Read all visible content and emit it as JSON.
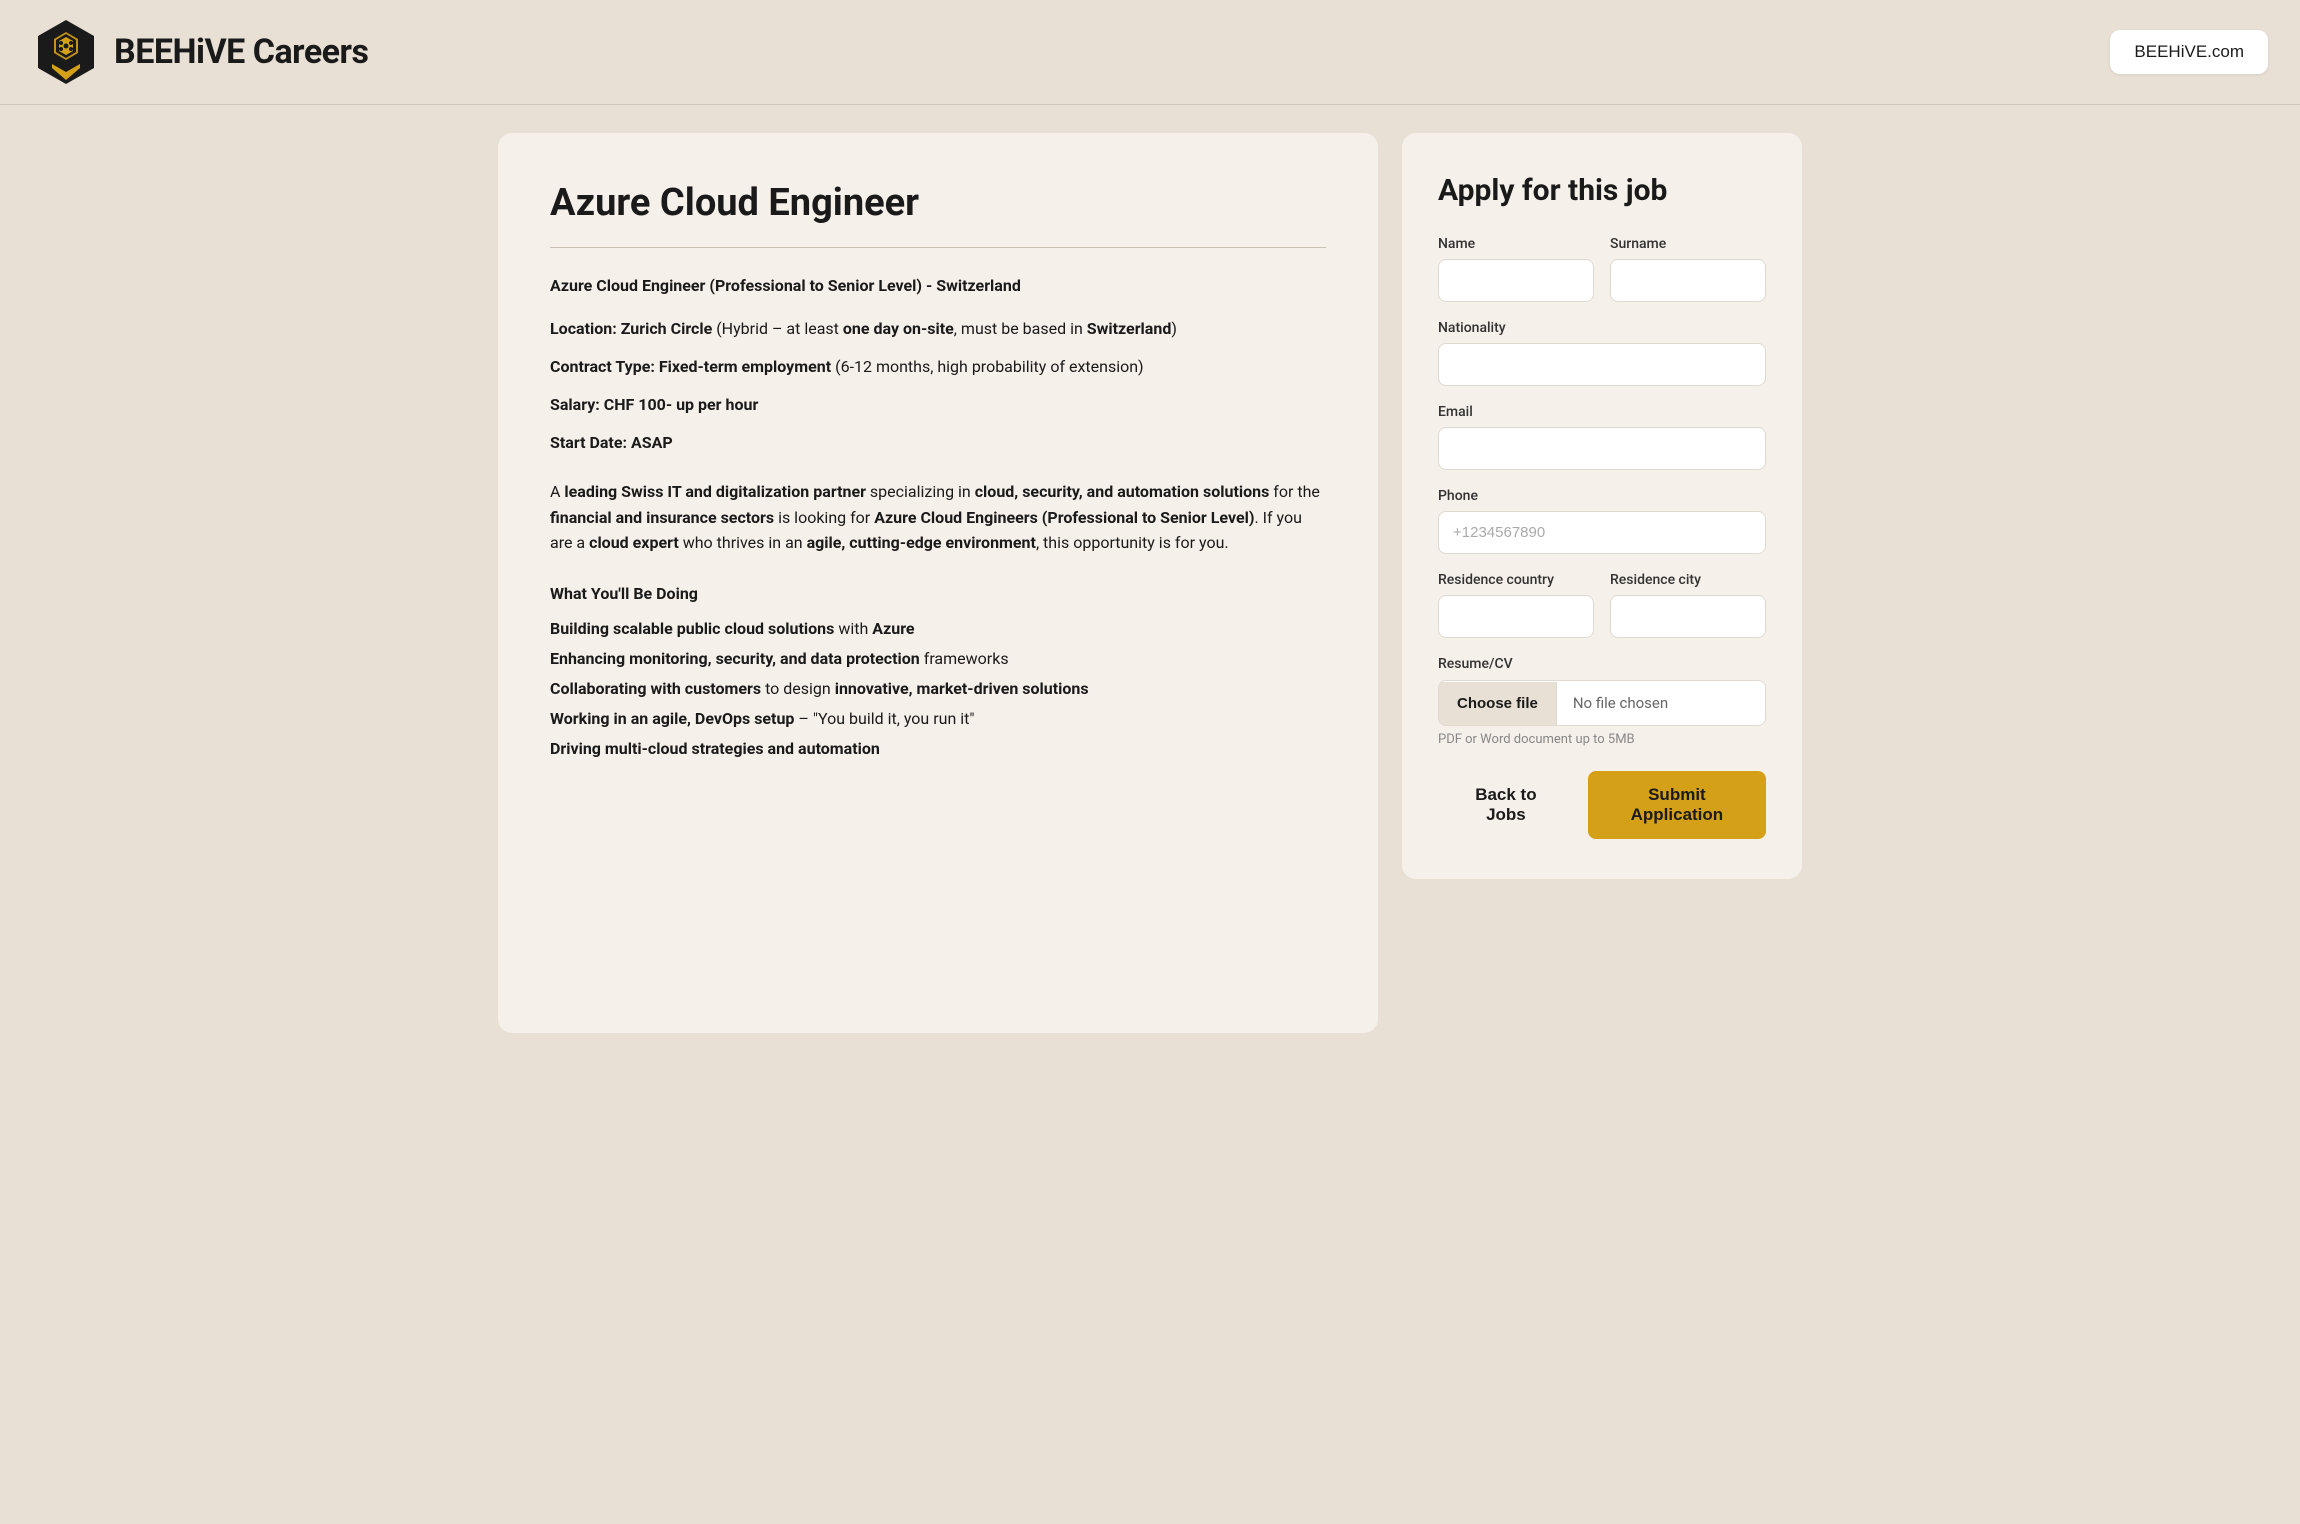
{
  "header": {
    "logo_text": "BEEHiVE Careers",
    "site_link": "BEEHiVE.com"
  },
  "job": {
    "title": "Azure Cloud Engineer",
    "subtitle": "Azure Cloud Engineer (Professional to Senior Level) - Switzerland",
    "details": [
      {
        "label": "Location: Zurich Circle",
        "rest": "(Hybrid – at least ",
        "bold_mid": "one day on-site",
        "rest2": ", must be based in ",
        "bold_end": "Switzerland",
        "suffix": ")"
      }
    ],
    "contract": "Contract Type: Fixed-term employment",
    "contract_rest": "(6-12 months, high probability of extension)",
    "salary": "Salary: CHF 100- up per hour",
    "start_date": "Start Date: ASAP",
    "intro": "A leading Swiss IT and digitalization partner specializing in cloud, security, and automation solutions for the financial and insurance sectors is looking for Azure Cloud Engineers (Professional to Senior Level). If you are a cloud expert who thrives in an agile, cutting-edge environment, this opportunity is for you.",
    "what_heading": "What You'll Be Doing",
    "doing_items": [
      "Building scalable public cloud solutions with Azure",
      "Enhancing monitoring, security, and data protection frameworks",
      "Collaborating with customers to design innovative, market-driven solutions",
      "Working in an agile, DevOps setup – \"You build it, you run it\"",
      "Driving multi-cloud strategies and automation"
    ]
  },
  "form": {
    "title": "Apply for this job",
    "name_label": "Name",
    "surname_label": "Surname",
    "nationality_label": "Nationality",
    "email_label": "Email",
    "phone_label": "Phone",
    "phone_placeholder": "+1234567890",
    "residence_country_label": "Residence country",
    "residence_city_label": "Residence city",
    "resume_label": "Resume/CV",
    "choose_file_btn": "Choose file",
    "no_file_text": "No file chosen",
    "file_hint": "PDF or Word document up to 5MB",
    "back_btn": "Back to Jobs",
    "submit_btn": "Submit Application"
  }
}
